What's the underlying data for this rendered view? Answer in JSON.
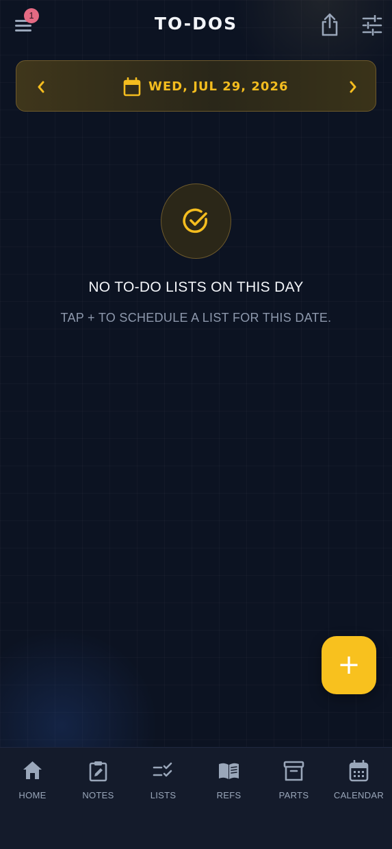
{
  "header": {
    "title": "TO-DOS",
    "menu_badge": "1"
  },
  "date_nav": {
    "date_label": "WED, JUL 29, 2026"
  },
  "empty_state": {
    "title": "NO TO-DO LISTS ON THIS DAY",
    "subtitle": "TAP + TO SCHEDULE A LIST FOR THIS DATE."
  },
  "fab": {
    "label": "+"
  },
  "bottom_nav": {
    "items": [
      {
        "label": "HOME",
        "icon": "home-icon"
      },
      {
        "label": "NOTES",
        "icon": "clipboard-pencil-icon"
      },
      {
        "label": "LISTS",
        "icon": "checklist-icon"
      },
      {
        "label": "REFS",
        "icon": "book-icon"
      },
      {
        "label": "PARTS",
        "icon": "archive-box-icon"
      },
      {
        "label": "CALENDAR",
        "icon": "calendar-icon"
      }
    ]
  },
  "colors": {
    "accent": "#f8c11e",
    "background": "#0c1322",
    "badge": "#e46a83",
    "muted_text": "#8e99ad"
  }
}
